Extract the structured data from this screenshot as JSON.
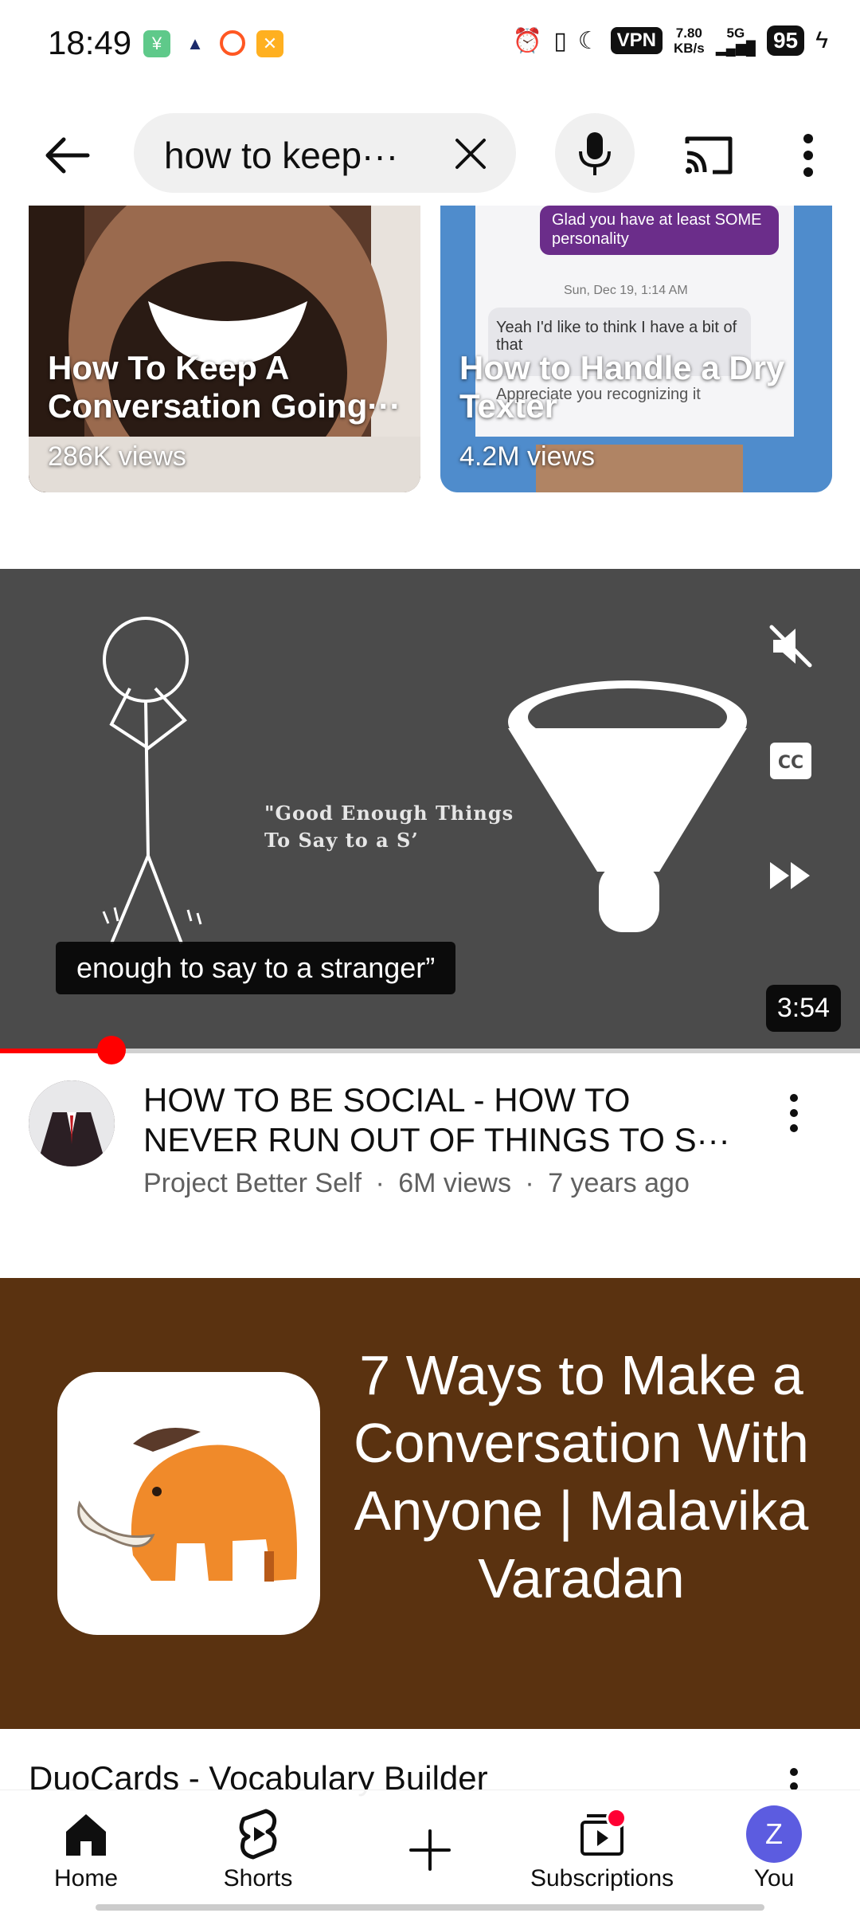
{
  "status_bar": {
    "time": "18:49",
    "vpn": "VPN",
    "net_speed_value": "7.80",
    "net_speed_unit": "KB/s",
    "network": "5G",
    "battery": "95"
  },
  "search": {
    "query": "how to keep···"
  },
  "shorts": [
    {
      "title": "How To Keep A Conversation Going···",
      "views": "286K views"
    },
    {
      "title": "How to Handle a Dry Texter",
      "views": "4.2M views",
      "chat_bubble": "Glad you have at least SOME personality",
      "chat_date": "Sun, Dec 19, 1:14 AM",
      "chat_reply": "Yeah I'd like to think I have a bit of that",
      "chat_reply2": "Appreciate you recognizing it"
    }
  ],
  "player": {
    "slide_text": "\"Good Enough Things To Say to a S’",
    "caption": "enough to say to a stranger”",
    "duration": "3:54",
    "progress": 0.13
  },
  "video": {
    "title": "HOW TO BE SOCIAL - HOW TO NEVER RUN OUT OF THINGS TO S···",
    "channel": "Project Better Self",
    "views": "6M views",
    "age": "7 years ago",
    "separator": "·"
  },
  "ad": {
    "headline": "7 Ways to Make a Conversation With Anyone | Malavika Varadan",
    "title": "DuoCards - Vocabulary Builder",
    "brand_color": "#5a3210"
  },
  "bottom_nav": {
    "home": "Home",
    "shorts": "Shorts",
    "subscriptions": "Subscriptions",
    "you": "You",
    "you_initial": "Z"
  }
}
